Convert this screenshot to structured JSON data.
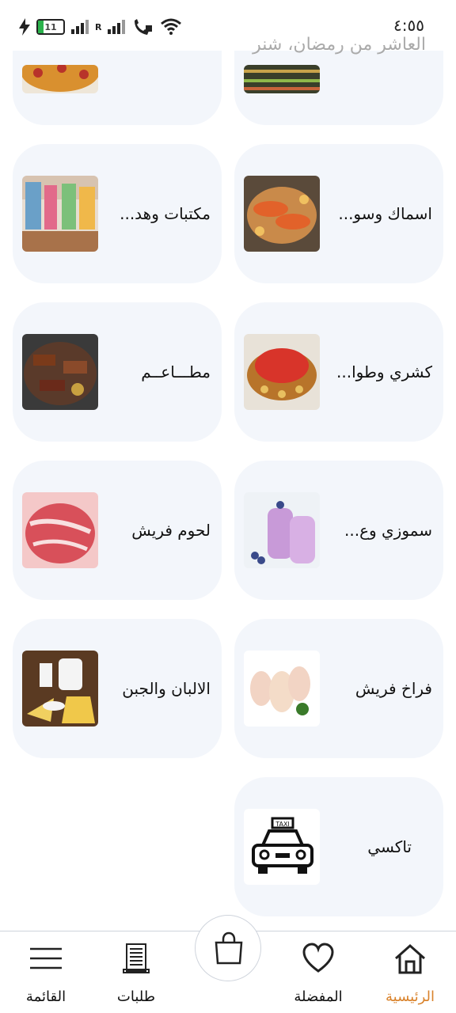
{
  "status_bar": {
    "time": "٤:٥٥",
    "battery": "11",
    "network_label": "R"
  },
  "header_partial_text": "العاشر من رمضان، شنر",
  "categories": [
    {
      "label": "",
      "thumb": "pizza"
    },
    {
      "label": "",
      "thumb": "supermarket"
    },
    {
      "label": "مكتبات وهد...",
      "thumb": "bookstore"
    },
    {
      "label": "اسماك وسو...",
      "thumb": "seafood"
    },
    {
      "label": "مطـــاعــم",
      "thumb": "grill"
    },
    {
      "label": "كشري وطوا...",
      "thumb": "koshari"
    },
    {
      "label": "لحوم فريش",
      "thumb": "meat"
    },
    {
      "label": "سموزي وع...",
      "thumb": "smoothie"
    },
    {
      "label": "الالبان والجبن",
      "thumb": "dairy"
    },
    {
      "label": "فراخ فريش",
      "thumb": "chicken"
    },
    {
      "label": "تاكسي",
      "thumb": "taxi"
    }
  ],
  "nav": {
    "home": "الرئيسية",
    "favorites": "المفضلة",
    "orders": "طلبات",
    "menu": "القائمة"
  },
  "colors": {
    "card_bg": "#f3f6fb",
    "accent": "#d9822b"
  }
}
